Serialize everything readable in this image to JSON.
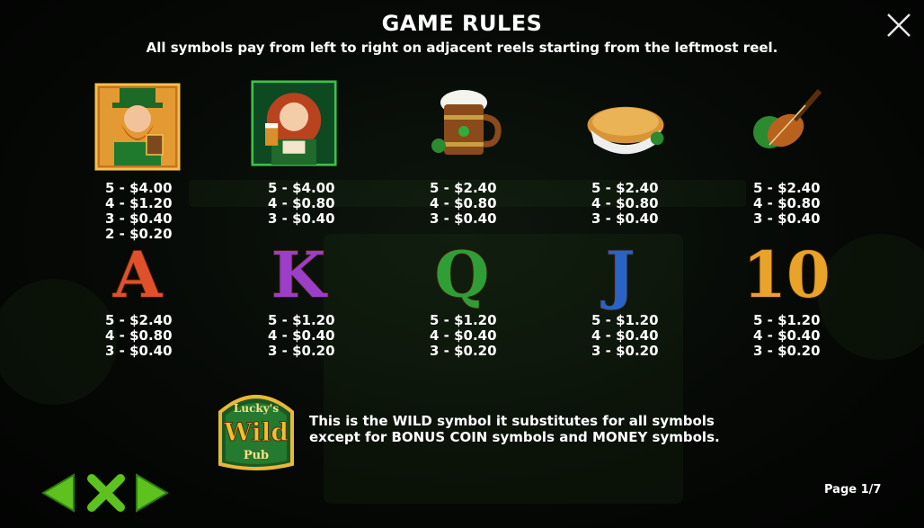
{
  "header": {
    "title": "GAME RULES",
    "subtitle": "All symbols pay from left to right on adjacent reels starting from the leftmost reel."
  },
  "symbols_row1": [
    {
      "icon": "leprechaun-symbol-icon",
      "pays": [
        "5 - $4.00",
        "4 - $1.20",
        "3 - $0.40",
        "2 - $0.20"
      ]
    },
    {
      "icon": "barmaid-symbol-icon",
      "pays": [
        "5 - $4.00",
        "4 - $0.80",
        "3 - $0.40"
      ]
    },
    {
      "icon": "beer-mug-symbol-icon",
      "pays": [
        "5 - $2.40",
        "4 - $0.80",
        "3 - $0.40"
      ]
    },
    {
      "icon": "pie-symbol-icon",
      "pays": [
        "5 - $2.40",
        "4 - $0.80",
        "3 - $0.40"
      ]
    },
    {
      "icon": "fiddle-symbol-icon",
      "pays": [
        "5 - $2.40",
        "4 - $0.80",
        "3 - $0.40"
      ]
    }
  ],
  "symbols_row2": [
    {
      "glyph": "A",
      "icon": "letter-a-symbol-icon",
      "pays": [
        "5 - $2.40",
        "4 - $0.80",
        "3 - $0.40"
      ]
    },
    {
      "glyph": "K",
      "icon": "letter-k-symbol-icon",
      "pays": [
        "5 - $1.20",
        "4 - $0.40",
        "3 - $0.20"
      ]
    },
    {
      "glyph": "Q",
      "icon": "letter-q-symbol-icon",
      "pays": [
        "5 - $1.20",
        "4 - $0.40",
        "3 - $0.20"
      ]
    },
    {
      "glyph": "J",
      "icon": "letter-j-symbol-icon",
      "pays": [
        "5 - $1.20",
        "4 - $0.40",
        "3 - $0.20"
      ]
    },
    {
      "glyph": "10",
      "icon": "ten-symbol-icon",
      "pays": [
        "5 - $1.20",
        "4 - $0.40",
        "3 - $0.20"
      ]
    }
  ],
  "wild": {
    "logo_text": [
      "Lucky's",
      "Wild",
      "Pub"
    ],
    "description_line1": "This is the WILD symbol it substitutes for all symbols",
    "description_line2": "except for BONUS COIN symbols and MONEY symbols."
  },
  "footer": {
    "page_indicator": "Page 1/7"
  },
  "colors": {
    "text": "#ffffff",
    "nav_green": "#5dc21e",
    "gold": "#f0b93a"
  }
}
